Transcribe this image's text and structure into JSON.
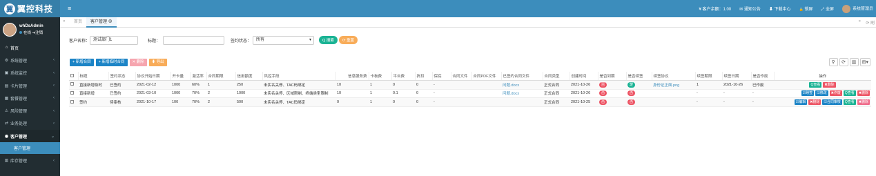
{
  "app": {
    "logo_mark": "翼",
    "logo_text": "翼控科技",
    "hamburger": "≡"
  },
  "topbar": {
    "balance_icon": "¥",
    "balance": "客户余额：1.00",
    "notice_icon": "✉",
    "notice": "通知公告",
    "download_icon": "⬇",
    "download": "下载中心",
    "lock_icon": "🔒",
    "lock": "锁屏",
    "fullscreen_icon": "⤢",
    "fullscreen": "全屏",
    "admin": "系统管理员"
  },
  "user": {
    "name": "whDsAdmin",
    "online": "在线",
    "logout_icon": "➜",
    "logout": "注销"
  },
  "sidebar": {
    "items": [
      {
        "icon": "⌂",
        "label": "首页"
      },
      {
        "icon": "⚙",
        "label": "系统管理"
      },
      {
        "icon": "▣",
        "label": "系统监控"
      },
      {
        "icon": "▤",
        "label": "卡片管理"
      },
      {
        "icon": "▦",
        "label": "套餐管理"
      },
      {
        "icon": "⚠",
        "label": "风险管理"
      },
      {
        "icon": "⇄",
        "label": "业务处理"
      },
      {
        "icon": "◉",
        "label": "客户管理"
      },
      {
        "icon": "▥",
        "label": "库存管理"
      }
    ],
    "sub_active": "客户管理",
    "arrow": "‹",
    "arrow_open": "⌄"
  },
  "tabs": {
    "prev": "«",
    "home": "首页",
    "active": "客户管理",
    "close": "⊗",
    "next": "»",
    "refresh": "⟳ 刷"
  },
  "search": {
    "customer_label": "客户名称：",
    "customer_value": "测试部门1",
    "title_label": "标题：",
    "title_value": "",
    "status_label": "签约状态：",
    "status_value": "所有",
    "status_caret": "▾",
    "search_btn": "Q 搜索",
    "reset_btn": "⟳ 重置"
  },
  "toolbar": {
    "add": "+ 新增合同",
    "add_temp": "+ 新增临时合同",
    "del": "✕ 删除",
    "export": "⬇ 导出"
  },
  "rtools": {
    "search": "⚲",
    "refresh": "⟳",
    "columns": "▥",
    "view": "⊞▾"
  },
  "colors": {
    "topbar": "#3c8dbc",
    "sidebar": "#222d32",
    "green": "#1ab394",
    "orange": "#f8ac59",
    "red": "#ed5565",
    "blue": "#1c84c6",
    "pink": "#ef6b8a"
  },
  "table": {
    "headers": [
      "标题",
      "签约状态",
      "协议开始日期",
      "开卡量",
      "激活率",
      "合同期限",
      "信用额度",
      "风控手段",
      "信息服务费",
      "卡板费",
      "平台费",
      "折扣",
      "保底",
      "合同文件",
      "合同PDF文件",
      "已签约合同文件",
      "合同类型",
      "创建时间",
      "是否到期",
      "是否续签",
      "续签协议",
      "续签期限",
      "续签日期",
      "是否作废",
      "操作"
    ],
    "rows": [
      {
        "title": "直接新增临时",
        "status": "已签约",
        "start": "2021-02-12",
        "cards": "1000",
        "rate": "60%",
        "term": "1",
        "credit": "250",
        "risk": "未实名关停、TAC码绑定",
        "info": "10",
        "board": "1",
        "plat": "0",
        "disc": "0",
        "floor": "-",
        "file": "",
        "pdf": "",
        "signed": "问题.docx",
        "type": "正式合同",
        "created": "2021-10-26",
        "expired": "否",
        "renew": "是",
        "renew_doc": "身份证正面.png",
        "renew_term": "1",
        "renew_date": "2021-10-26",
        "void": "已作废",
        "ops": [
          {
            "l": "Q查看",
            "c": "#1ab394"
          },
          {
            "l": "✖删除",
            "c": "#ed5565"
          }
        ]
      },
      {
        "title": "直接新增",
        "status": "已签约",
        "start": "2021-03-10",
        "cards": "1000",
        "rate": "70%",
        "term": "2",
        "credit": "1000",
        "risk": "未实名关停、区域限制、终端类型限制",
        "info": "10",
        "board": "1",
        "plat": "0.1",
        "disc": "0",
        "floor": "-",
        "file": "",
        "pdf": "",
        "signed": "问题.docx",
        "type": "正式合同",
        "created": "2021-10-26",
        "expired": "否",
        "renew": "否",
        "renew_doc": "",
        "renew_term": "-",
        "renew_date": "-",
        "void": "-",
        "ops": [
          {
            "l": "☑续签",
            "c": "#1c84c6"
          },
          {
            "l": "☑修改",
            "c": "#1c84c6"
          },
          {
            "l": "✖作废",
            "c": "#ed5565"
          },
          {
            "l": "Q查看",
            "c": "#1ab394"
          },
          {
            "l": "✖删除",
            "c": "#ed5565"
          }
        ]
      },
      {
        "title": "签约",
        "status": "待审核",
        "start": "2021-10-17",
        "cards": "100",
        "rate": "70%",
        "term": "2",
        "credit": "500",
        "risk": "未实名关停、TAC码绑定",
        "info": "0",
        "board": "1",
        "plat": "0",
        "disc": "0",
        "floor": "-",
        "file": "",
        "pdf": "",
        "signed": "",
        "type": "正式合同",
        "created": "2021-10-25",
        "expired": "否",
        "renew": "否",
        "renew_doc": "",
        "renew_term": "-",
        "renew_date": "-",
        "void": "-",
        "ops": [
          {
            "l": "☑编辑",
            "c": "#1c84c6"
          },
          {
            "l": "✖删除",
            "c": "#ed5565"
          },
          {
            "l": "☑合同审核",
            "c": "#1c84c6"
          },
          {
            "l": "Q查看",
            "c": "#1ab394"
          },
          {
            "l": "✖删除",
            "c": "#ef6b8a"
          }
        ]
      }
    ]
  }
}
